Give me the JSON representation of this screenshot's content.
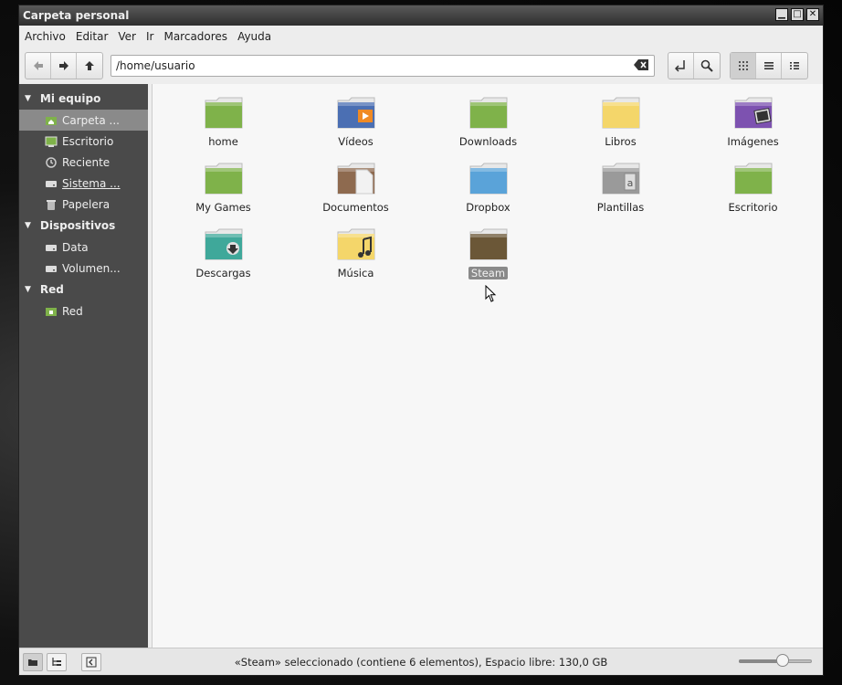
{
  "window": {
    "title": "Carpeta personal"
  },
  "menu": [
    "Archivo",
    "Editar",
    "Ver",
    "Ir",
    "Marcadores",
    "Ayuda"
  ],
  "toolbar": {
    "path": "/home/usuario"
  },
  "sidebar": {
    "sections": [
      {
        "header": "Mi equipo",
        "items": [
          {
            "label": "Carpeta ...",
            "icon": "home-folder-icon",
            "selected": true
          },
          {
            "label": "Escritorio",
            "icon": "desktop-icon"
          },
          {
            "label": "Reciente",
            "icon": "recent-icon"
          },
          {
            "label": "Sistema ...",
            "icon": "drive-icon"
          },
          {
            "label": "Papelera",
            "icon": "trash-icon"
          }
        ]
      },
      {
        "header": "Dispositivos",
        "items": [
          {
            "label": "Data",
            "icon": "drive-icon"
          },
          {
            "label": "Volumen...",
            "icon": "drive-icon"
          }
        ]
      },
      {
        "header": "Red",
        "items": [
          {
            "label": "Red",
            "icon": "network-icon"
          }
        ]
      }
    ]
  },
  "files": [
    {
      "name": "home",
      "color": "#7fb24a",
      "icon": "folder-icon"
    },
    {
      "name": "Vídeos",
      "color": "#4b6fb3",
      "icon": "video-folder-icon"
    },
    {
      "name": "Downloads",
      "color": "#7fb24a",
      "icon": "folder-icon"
    },
    {
      "name": "Libros",
      "color": "#f4d66a",
      "icon": "folder-icon"
    },
    {
      "name": "Imágenes",
      "color": "#7d52b0",
      "icon": "pictures-folder-icon"
    },
    {
      "name": "My Games",
      "color": "#7fb24a",
      "icon": "folder-icon"
    },
    {
      "name": "Documentos",
      "color": "#8e6a4f",
      "icon": "documents-folder-icon"
    },
    {
      "name": "Dropbox",
      "color": "#5aa3d9",
      "icon": "folder-icon"
    },
    {
      "name": "Plantillas",
      "color": "#9a9a9a",
      "icon": "templates-folder-icon"
    },
    {
      "name": "Escritorio",
      "color": "#7fb24a",
      "icon": "folder-icon"
    },
    {
      "name": "Descargas",
      "color": "#3fa89a",
      "icon": "downloads-folder-icon"
    },
    {
      "name": "Música",
      "color": "#f4d66a",
      "icon": "music-folder-icon"
    },
    {
      "name": "Steam",
      "color": "#6b5737",
      "icon": "folder-icon",
      "selected": true
    }
  ],
  "status": {
    "text": "«Steam» seleccionado (contiene 6 elementos), Espacio libre: 130,0 GB",
    "zoom_level": 0.6
  }
}
